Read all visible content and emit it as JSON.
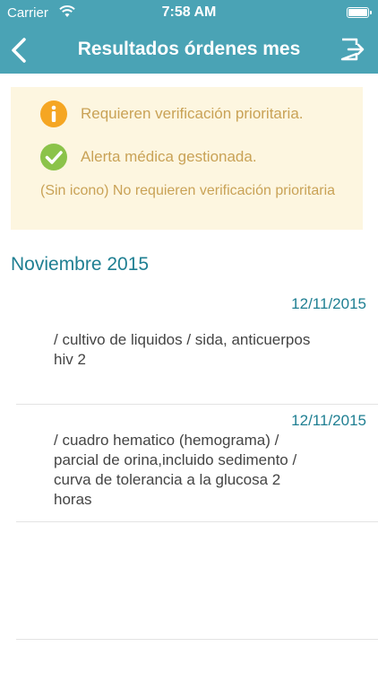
{
  "status_bar": {
    "carrier": "Carrier",
    "time": "7:58 AM"
  },
  "nav": {
    "title": "Resultados órdenes mes",
    "back_icon": "chevron-left-icon",
    "logout_icon": "logout-icon"
  },
  "legend": {
    "items": [
      {
        "icon": "info-icon",
        "color": "#f5a623",
        "label": "Requieren verificación prioritaria."
      },
      {
        "icon": "check-icon",
        "color": "#8bc34a",
        "label": "Alerta médica gestionada."
      }
    ],
    "note": "(Sin icono) No requieren verificación prioritaria"
  },
  "section": {
    "title": "Noviembre 2015"
  },
  "orders": [
    {
      "date": "12/11/2015",
      "description": " / cultivo de liquidos / sida, anticuerpos hiv 2"
    },
    {
      "date": "12/11/2015",
      "description": " / cuadro hematico (hemograma) / parcial de orina,incluido sedimento / curva de tolerancia a la glucosa 2 horas"
    }
  ],
  "colors": {
    "accent": "#4aa3b5",
    "section_text": "#1f7f92",
    "legend_bg": "#fdf6e0",
    "legend_text": "#c9a256"
  }
}
